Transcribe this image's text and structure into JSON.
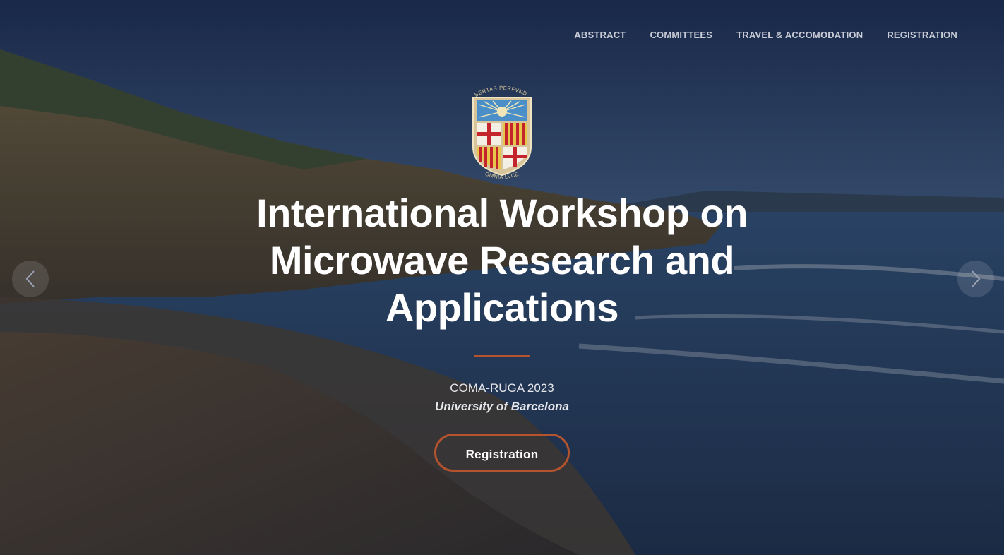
{
  "nav": {
    "items": [
      {
        "label": "ABSTRACT"
      },
      {
        "label": "COMMITTEES"
      },
      {
        "label": "TRAVEL & ACCOMODATION"
      },
      {
        "label": "REGISTRATION"
      }
    ]
  },
  "logo": {
    "motto_top": "LIBERTAS PERFVNDET",
    "motto_bottom": "OMNIA LVCE"
  },
  "hero": {
    "title": "International Workshop on Microwave Research and Applications",
    "subtitle": "COMA-RUGA 2023",
    "institution": "University of Barcelona",
    "cta_label": "Registration"
  },
  "carousel": {
    "prev_icon": "chevron-left-icon",
    "next_icon": "chevron-right-icon"
  },
  "colors": {
    "accent": "#b5532e",
    "overlay": "#141c34"
  }
}
